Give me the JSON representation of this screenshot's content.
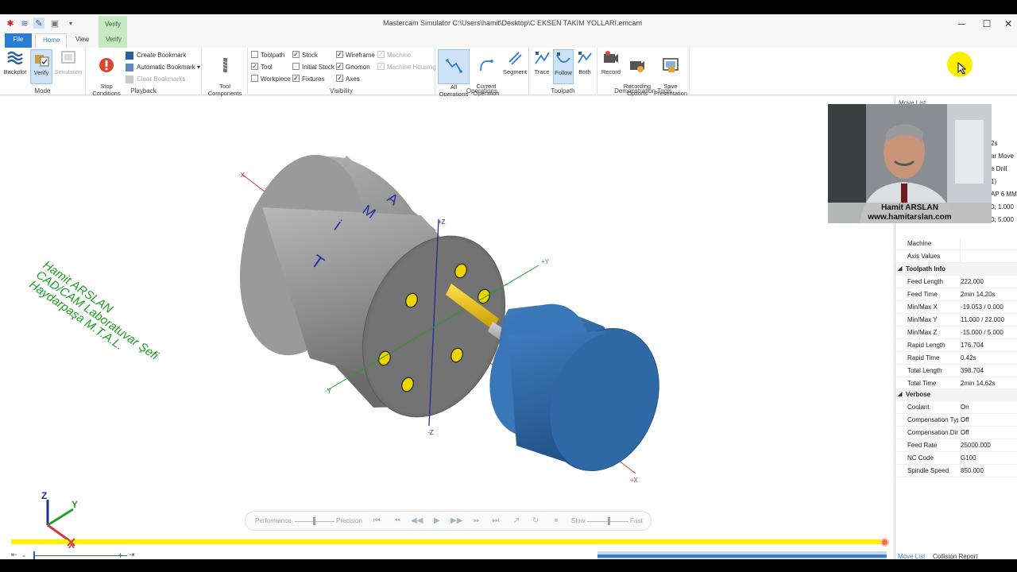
{
  "window": {
    "title": "Mastercam Simulator  C:\\Users\\hamit\\Desktop\\C EKSEN TAKIM YOLLARI.emcam",
    "minimize": "─",
    "maximize": "☐",
    "close": "✕"
  },
  "tabs": {
    "file": "File",
    "home": "Home",
    "view": "View",
    "verify_context": "Verify",
    "verify": "Verify"
  },
  "ribbon": {
    "mode": {
      "label": "Mode",
      "backplot": "Backplot",
      "verify": "Verify",
      "simulation": "Simulation"
    },
    "playback": {
      "label": "Playback",
      "stop_conditions": "Stop\nConditions",
      "create_bookmark": "Create Bookmark",
      "automatic_bookmark": "Automatic Bookmark",
      "clear_bookmarks": "Clear Bookmarks"
    },
    "tool_components": "Tool\nComponents",
    "visibility": {
      "label": "Visibility",
      "toolpath": "Toolpath",
      "tool": "Tool",
      "workpiece": "Workpiece",
      "stock": "Stock",
      "initial_stock": "Initial Stock",
      "fixtures": "Fixtures",
      "wireframe": "Wireframe",
      "gnomon": "Gnomon",
      "axes": "Axes",
      "machine": "Machine",
      "machine_housing": "Machine Housing",
      "checked": "✓"
    },
    "operations": {
      "label": "Operations",
      "all": "All\nOperations",
      "current": "Current\nOperation",
      "segment": "Segment"
    },
    "toolpath": {
      "label": "Toolpath",
      "trace": "Trace",
      "follow": "Follow",
      "both": "Both"
    },
    "demo": {
      "label": "Demonstration Tools",
      "record": "Record",
      "recording_options": "Recording\nOptions",
      "save_presentation": "Save\nPresentation"
    }
  },
  "viewport": {
    "watermark_line1": "Hamit ARSLAN",
    "watermark_line2": "CAD/CAM Laboratuvar  Şefi",
    "watermark_line3": "Haydarpaşa M.T.A.L.",
    "axis_labels": {
      "neg_x_top": "-X",
      "pos_z": "+Z",
      "pos_y": "+Y",
      "neg_y": "-Y",
      "neg_z": "-Z",
      "pos_x": "+X"
    },
    "engraved_letters": [
      "A",
      "M",
      "İ",
      "T"
    ],
    "gnomon": {
      "z": "Z",
      "y": "Y",
      "x": "X"
    }
  },
  "playbar": {
    "performance": "Performance",
    "precision": "Precision",
    "slow": "Slow",
    "fast": "Fast"
  },
  "timeline": {
    "zoom_out": "-",
    "zoom_in": "+"
  },
  "properties": {
    "header": "Move List",
    "peek": [
      "2s",
      "ar Move",
      "e Drill",
      "1)",
      "AP 6 MM",
      "0; 1.000",
      "0; 5.000"
    ],
    "top_rows": [
      {
        "key": "Machine",
        "value": ""
      },
      {
        "key": "Axis Values",
        "value": ""
      }
    ],
    "toolpath_info": {
      "label": "Toolpath Info",
      "rows": [
        {
          "key": "Feed Length",
          "value": "222.000"
        },
        {
          "key": "Feed Time",
          "value": "2min 14.20s"
        },
        {
          "key": "Min/Max X",
          "value": "-19.053 / 0.000"
        },
        {
          "key": "Min/Max Y",
          "value": "11.000 / 22.000"
        },
        {
          "key": "Min/Max Z",
          "value": "-15.000 / 5.000"
        },
        {
          "key": "Rapid Length",
          "value": "176.704"
        },
        {
          "key": "Rapid Time",
          "value": "0.42s"
        },
        {
          "key": "Total Length",
          "value": "398.704"
        },
        {
          "key": "Total Time",
          "value": "2min 14.62s"
        }
      ]
    },
    "verbose": {
      "label": "Verbose",
      "rows": [
        {
          "key": "Coolant",
          "value": "On"
        },
        {
          "key": "Compensation Type",
          "value": "Off"
        },
        {
          "key": "Compensation Direction",
          "value": "Off"
        },
        {
          "key": "Feed Rate",
          "value": "25000.000"
        },
        {
          "key": "NC Code",
          "value": "G100"
        },
        {
          "key": "Spindle Speed",
          "value": "850.000"
        }
      ]
    },
    "tabs": {
      "move_list": "Move List",
      "collision_report": "Collision Report"
    }
  },
  "webcam": {
    "name": "Hamit ARSLAN",
    "website": "www.hamitarslan.com"
  },
  "colors": {
    "accent": "#2b7cd3",
    "timeline": "#fff200",
    "stock": "#8c8c8c",
    "fixture": "#2f6aa8",
    "tool": "#e3b600",
    "watermark": "#19a01f"
  }
}
